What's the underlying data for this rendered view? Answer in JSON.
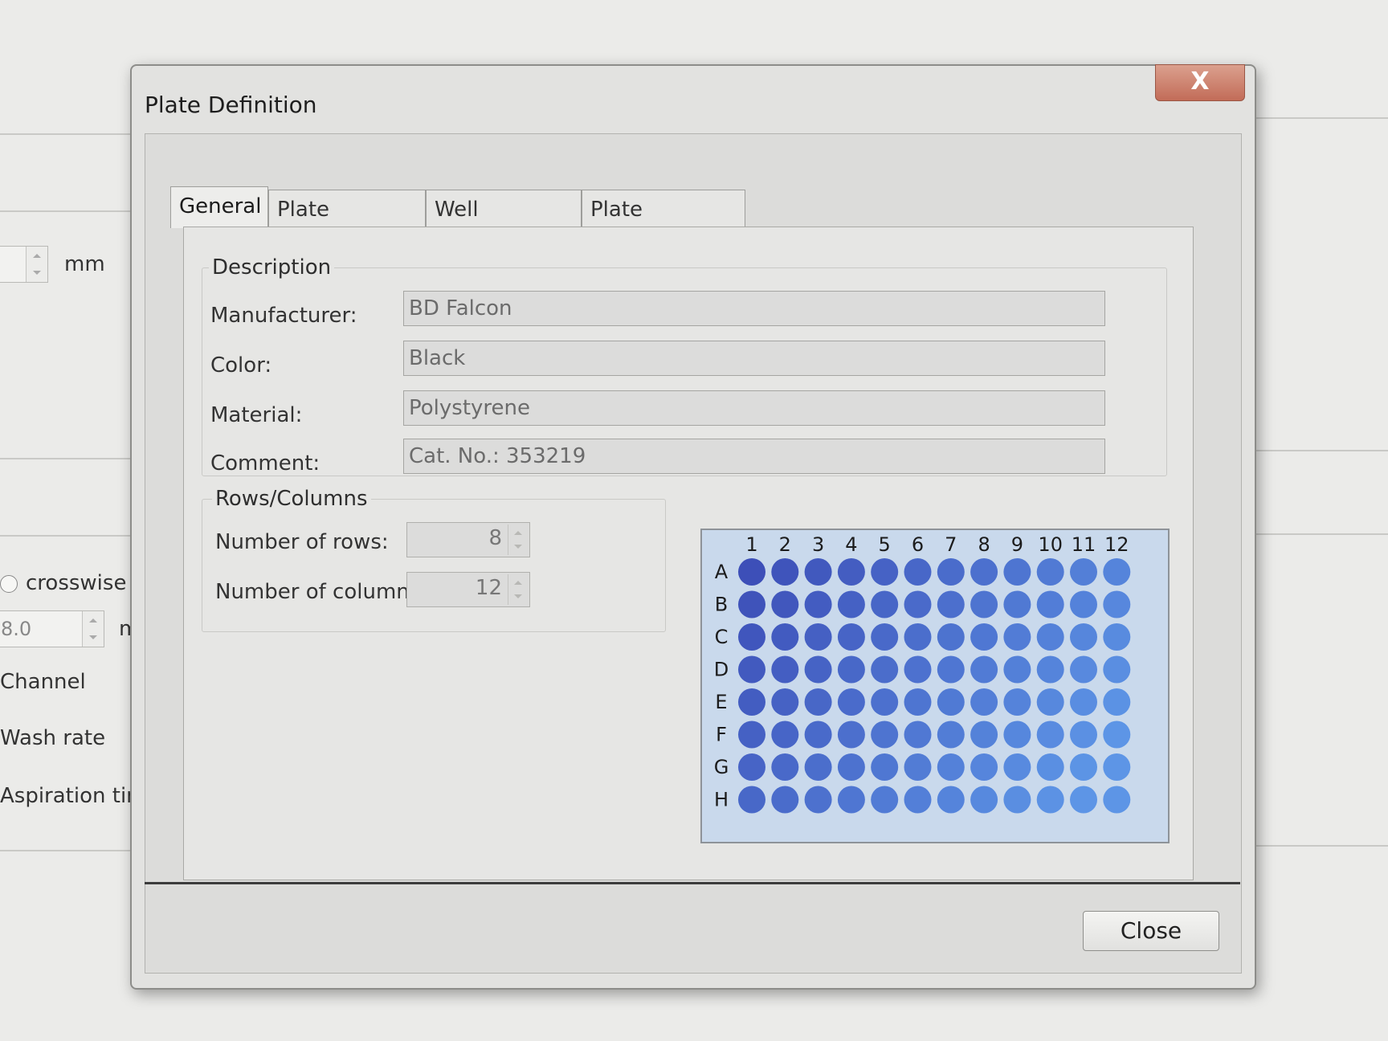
{
  "background": {
    "unit_label": "mm",
    "crosswise_label": "crosswise",
    "spin_value": "8.0",
    "unit_fragment": "m",
    "channel_label": "Channel",
    "wash_rate_label": "Wash rate",
    "aspiration_time_label": "Aspiration time"
  },
  "dialog": {
    "title": "Plate Definition",
    "close_x": "X",
    "close_button": "Close"
  },
  "tabs": [
    {
      "label": "General",
      "active": true
    },
    {
      "label": "Plate Geometry",
      "active": false
    },
    {
      "label": "Well Geometry",
      "active": false
    },
    {
      "label": "Plate Parameter",
      "active": false
    }
  ],
  "description": {
    "group_title": "Description",
    "fields": [
      {
        "label": "Manufacturer:",
        "value": "BD Falcon"
      },
      {
        "label": "Color:",
        "value": "Black"
      },
      {
        "label": "Material:",
        "value": "Polystyrene"
      },
      {
        "label": "Comment:",
        "value": "Cat. No.: 353219"
      }
    ]
  },
  "rows_columns": {
    "group_title": "Rows/Columns",
    "rows_label": "Number of rows:",
    "rows_value": "8",
    "columns_label": "Number of columns:",
    "columns_value": "12"
  },
  "plate": {
    "column_labels": [
      "1",
      "2",
      "3",
      "4",
      "5",
      "6",
      "7",
      "8",
      "9",
      "10",
      "11",
      "12"
    ],
    "row_labels": [
      "A",
      "B",
      "C",
      "D",
      "E",
      "F",
      "G",
      "H"
    ],
    "well_color_dark": "#3d4fb8",
    "well_color_light": "#5d95e6",
    "plate_color": "#c9d9ec"
  }
}
